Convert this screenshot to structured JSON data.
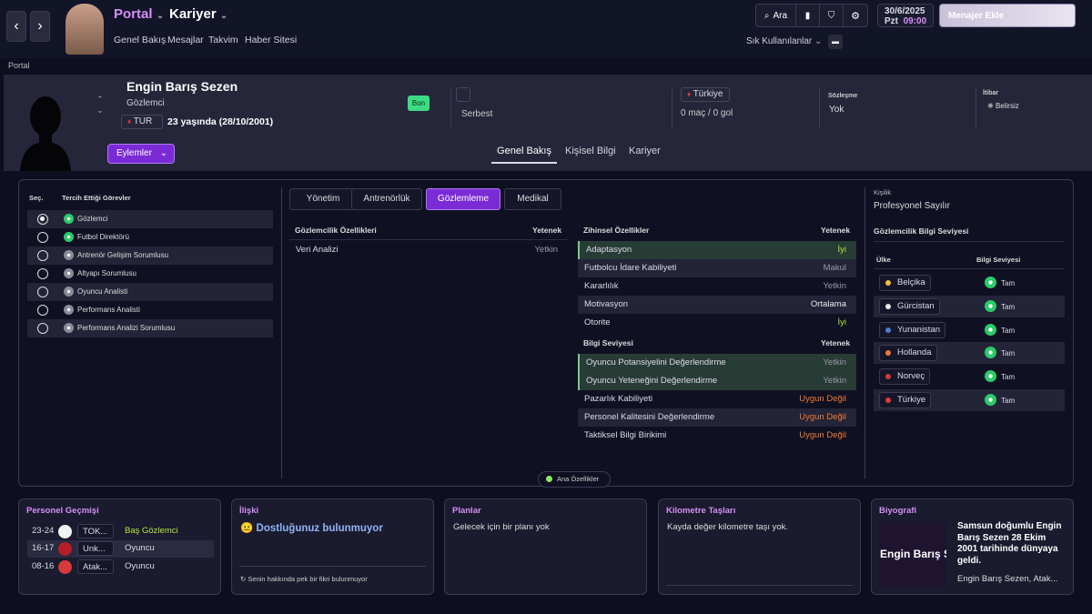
{
  "topbar": {
    "back_icon": "chevron-left-icon",
    "forward_icon": "chevron-right-icon",
    "portal": "Portal",
    "kariyer": "Kariyer",
    "subnav": [
      "Genel Bakış",
      "Mesajlar",
      "Takvim",
      "Haber Sitesi"
    ],
    "search_label": "Ara",
    "date": "30/6/2025",
    "day": "Pzt",
    "time": "09:00",
    "manager_button": "Menajer Ekle",
    "quick_links": "Sık Kullanılanlar"
  },
  "breadcrumb": "Portal",
  "profile": {
    "name": "Engin Barış Sezen",
    "role": "Gözlemci",
    "nationality": "TUR",
    "age_text": "23 yaşında (28/10/2001)",
    "badge": "Bon",
    "status": "Serbest",
    "nation_team": "Türkiye",
    "caps": "0 maç / 0 gol",
    "contract_label": "Sözleşme",
    "contract_value": "Yok",
    "reputation_label": "İtibar",
    "reputation_value": "Belirsiz",
    "actions_button": "Eylemler",
    "tabs": [
      "Genel Bakış",
      "Kişisel Bilgi",
      "Kariyer"
    ],
    "active_tab": "Genel Bakış"
  },
  "roles": {
    "col_select": "Seç.",
    "col_role": "Tercih Ettiği Görevler",
    "items": [
      {
        "label": "Gözlemci",
        "selected": true,
        "icon_color": "#2acb6a"
      },
      {
        "label": "Futbol Direktörü",
        "selected": false,
        "icon_color": "#2acb6a"
      },
      {
        "label": "Antrenör Gelişim Sorumlusu",
        "selected": false,
        "icon_color": "#8a8a98"
      },
      {
        "label": "Altyapı Sorumlusu",
        "selected": false,
        "icon_color": "#8a8a98"
      },
      {
        "label": "Oyuncu Analisti",
        "selected": false,
        "icon_color": "#8a8a98"
      },
      {
        "label": "Performans Analisti",
        "selected": false,
        "icon_color": "#8a8a98"
      },
      {
        "label": "Performans Analizi Sorumlusu",
        "selected": false,
        "icon_color": "#8a8a98"
      }
    ]
  },
  "attr_tabs": [
    "Yönetim",
    "Antrenörlük",
    "Gözlemleme",
    "Medikal"
  ],
  "attr_active_tab": "Gözlemleme",
  "scouting": {
    "header": "Gözlemcilik Özellikleri",
    "value_header": "Yetenek",
    "rows": [
      {
        "label": "Veri Analizi",
        "value": "Yetkin"
      }
    ]
  },
  "mental": {
    "header": "Zihinsel Özellikler",
    "value_header": "Yetenek",
    "rows": [
      {
        "label": "Adaptasyon",
        "value": "İyi"
      },
      {
        "label": "Futbolcu İdare Kabiliyeti",
        "value": "Makul"
      },
      {
        "label": "Kararlılık",
        "value": "Yetkin"
      },
      {
        "label": "Motivasyon",
        "value": "Ortalama"
      },
      {
        "label": "Otorite",
        "value": "İyi"
      }
    ]
  },
  "knowledge": {
    "header": "Bilgi Seviyesi",
    "value_header": "Yetenek",
    "rows": [
      {
        "label": "Oyuncu Potansiyelini Değerlendirme",
        "value": "Yetkin"
      },
      {
        "label": "Oyuncu Yeteneğini Değerlendirme",
        "value": "Yetkin"
      },
      {
        "label": "Pazarlık Kabiliyeti",
        "value": "Uygun Değil"
      },
      {
        "label": "Personel Kalitesini Değerlendirme",
        "value": "Uygun Değil"
      },
      {
        "label": "Taktiksel Bilgi Birikimi",
        "value": "Uygun Değil"
      }
    ]
  },
  "key_attributes_toggle": "Ana Özellikler",
  "personality": {
    "label": "Kişilik",
    "value": "Profesyonel Sayılır"
  },
  "scout_knowledge": {
    "title": "Gözlemcilik Bilgi Seviyesi",
    "col_country": "Ülke",
    "col_level": "Bilgi Seviyesi",
    "rows": [
      {
        "country": "Belçika",
        "level": "Tam"
      },
      {
        "country": "Gürcistan",
        "level": "Tam"
      },
      {
        "country": "Yunanistan",
        "level": "Tam"
      },
      {
        "country": "Hollanda",
        "level": "Tam"
      },
      {
        "country": "Norveç",
        "level": "Tam"
      },
      {
        "country": "Türkiye",
        "level": "Tam"
      }
    ]
  },
  "history": {
    "title": "Personel Geçmişi",
    "rows": [
      {
        "years": "23-24",
        "club": "TOK...",
        "role": "Baş Gözlemci"
      },
      {
        "years": "16-17",
        "club": "Unk...",
        "role": "Oyuncu"
      },
      {
        "years": "08-16",
        "club": "Atak...",
        "role": "Oyuncu"
      }
    ]
  },
  "relationship": {
    "title": "İlişki",
    "headline": "Dostluğunuz bulunmuyor",
    "footer": "Senin hakkında pek bir fikri bulunmuyor"
  },
  "plans": {
    "title": "Planlar",
    "text": "Gelecek için bir planı yok"
  },
  "milestones": {
    "title": "Kilometre Taşları",
    "text": "Kayda değer kilometre taşı yok."
  },
  "biography": {
    "title": "Biyografi",
    "image_text": "Engin Barış Sezen",
    "text": "Samsun doğumlu Engin Barış Sezen 28 Ekim 2001 tarihinde dünyaya geldi.",
    "more": "Engin Barış Sezen, Atak..."
  }
}
